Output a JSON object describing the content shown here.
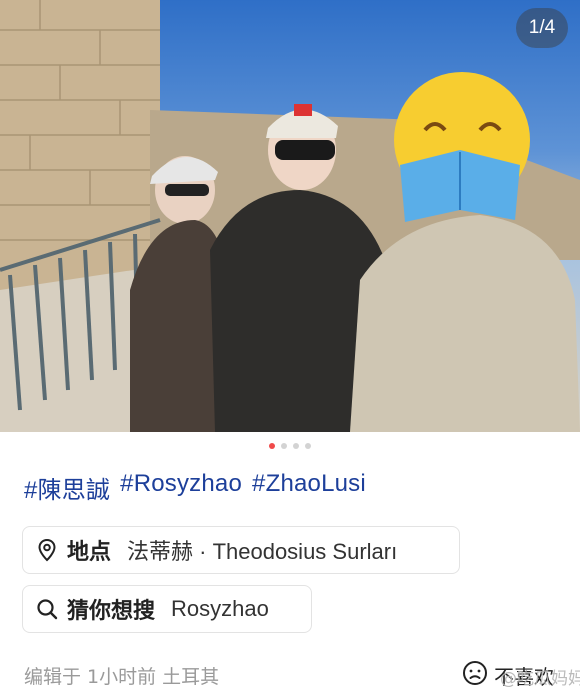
{
  "photo": {
    "counter": "1/4"
  },
  "pagination": {
    "total": 4,
    "active_index": 0
  },
  "hashtags": [
    "#陳思誠",
    "#Rosyzhao",
    "#ZhaoLusi"
  ],
  "location": {
    "icon": "location-pin-icon",
    "key": "地点",
    "value": "法蒂赫 · Theodosius Surları"
  },
  "search": {
    "icon": "search-icon",
    "key": "猜你想搜",
    "value": "Rosyzhao"
  },
  "footer": {
    "edit_info": "编辑于 1小时前 土耳其",
    "dislike_label": "不喜欢",
    "watermark": "@吃瓜妈妈"
  },
  "colors": {
    "hashtag": "#1d3f9a",
    "active_dot": "#f04a4a",
    "muted_text": "#9a9a9a"
  }
}
